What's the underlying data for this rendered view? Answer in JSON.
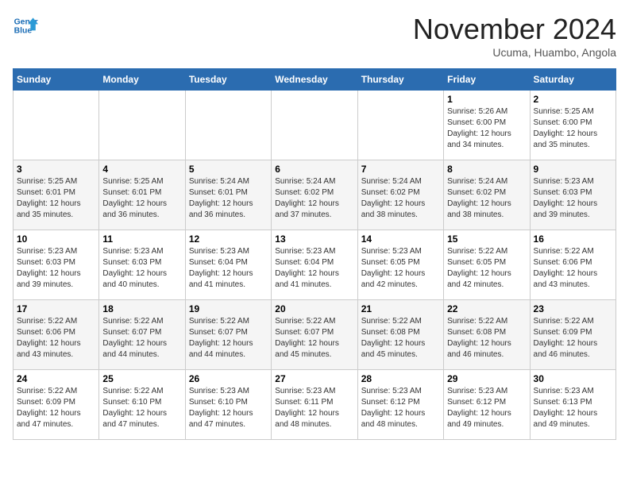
{
  "header": {
    "logo_line1": "General",
    "logo_line2": "Blue",
    "month_title": "November 2024",
    "location": "Ucuma, Huambo, Angola"
  },
  "weekdays": [
    "Sunday",
    "Monday",
    "Tuesday",
    "Wednesday",
    "Thursday",
    "Friday",
    "Saturday"
  ],
  "weeks": [
    [
      {
        "day": "",
        "info": ""
      },
      {
        "day": "",
        "info": ""
      },
      {
        "day": "",
        "info": ""
      },
      {
        "day": "",
        "info": ""
      },
      {
        "day": "",
        "info": ""
      },
      {
        "day": "1",
        "info": "Sunrise: 5:26 AM\nSunset: 6:00 PM\nDaylight: 12 hours and 34 minutes."
      },
      {
        "day": "2",
        "info": "Sunrise: 5:25 AM\nSunset: 6:00 PM\nDaylight: 12 hours and 35 minutes."
      }
    ],
    [
      {
        "day": "3",
        "info": "Sunrise: 5:25 AM\nSunset: 6:01 PM\nDaylight: 12 hours and 35 minutes."
      },
      {
        "day": "4",
        "info": "Sunrise: 5:25 AM\nSunset: 6:01 PM\nDaylight: 12 hours and 36 minutes."
      },
      {
        "day": "5",
        "info": "Sunrise: 5:24 AM\nSunset: 6:01 PM\nDaylight: 12 hours and 36 minutes."
      },
      {
        "day": "6",
        "info": "Sunrise: 5:24 AM\nSunset: 6:02 PM\nDaylight: 12 hours and 37 minutes."
      },
      {
        "day": "7",
        "info": "Sunrise: 5:24 AM\nSunset: 6:02 PM\nDaylight: 12 hours and 38 minutes."
      },
      {
        "day": "8",
        "info": "Sunrise: 5:24 AM\nSunset: 6:02 PM\nDaylight: 12 hours and 38 minutes."
      },
      {
        "day": "9",
        "info": "Sunrise: 5:23 AM\nSunset: 6:03 PM\nDaylight: 12 hours and 39 minutes."
      }
    ],
    [
      {
        "day": "10",
        "info": "Sunrise: 5:23 AM\nSunset: 6:03 PM\nDaylight: 12 hours and 39 minutes."
      },
      {
        "day": "11",
        "info": "Sunrise: 5:23 AM\nSunset: 6:03 PM\nDaylight: 12 hours and 40 minutes."
      },
      {
        "day": "12",
        "info": "Sunrise: 5:23 AM\nSunset: 6:04 PM\nDaylight: 12 hours and 41 minutes."
      },
      {
        "day": "13",
        "info": "Sunrise: 5:23 AM\nSunset: 6:04 PM\nDaylight: 12 hours and 41 minutes."
      },
      {
        "day": "14",
        "info": "Sunrise: 5:23 AM\nSunset: 6:05 PM\nDaylight: 12 hours and 42 minutes."
      },
      {
        "day": "15",
        "info": "Sunrise: 5:22 AM\nSunset: 6:05 PM\nDaylight: 12 hours and 42 minutes."
      },
      {
        "day": "16",
        "info": "Sunrise: 5:22 AM\nSunset: 6:06 PM\nDaylight: 12 hours and 43 minutes."
      }
    ],
    [
      {
        "day": "17",
        "info": "Sunrise: 5:22 AM\nSunset: 6:06 PM\nDaylight: 12 hours and 43 minutes."
      },
      {
        "day": "18",
        "info": "Sunrise: 5:22 AM\nSunset: 6:07 PM\nDaylight: 12 hours and 44 minutes."
      },
      {
        "day": "19",
        "info": "Sunrise: 5:22 AM\nSunset: 6:07 PM\nDaylight: 12 hours and 44 minutes."
      },
      {
        "day": "20",
        "info": "Sunrise: 5:22 AM\nSunset: 6:07 PM\nDaylight: 12 hours and 45 minutes."
      },
      {
        "day": "21",
        "info": "Sunrise: 5:22 AM\nSunset: 6:08 PM\nDaylight: 12 hours and 45 minutes."
      },
      {
        "day": "22",
        "info": "Sunrise: 5:22 AM\nSunset: 6:08 PM\nDaylight: 12 hours and 46 minutes."
      },
      {
        "day": "23",
        "info": "Sunrise: 5:22 AM\nSunset: 6:09 PM\nDaylight: 12 hours and 46 minutes."
      }
    ],
    [
      {
        "day": "24",
        "info": "Sunrise: 5:22 AM\nSunset: 6:09 PM\nDaylight: 12 hours and 47 minutes."
      },
      {
        "day": "25",
        "info": "Sunrise: 5:22 AM\nSunset: 6:10 PM\nDaylight: 12 hours and 47 minutes."
      },
      {
        "day": "26",
        "info": "Sunrise: 5:23 AM\nSunset: 6:10 PM\nDaylight: 12 hours and 47 minutes."
      },
      {
        "day": "27",
        "info": "Sunrise: 5:23 AM\nSunset: 6:11 PM\nDaylight: 12 hours and 48 minutes."
      },
      {
        "day": "28",
        "info": "Sunrise: 5:23 AM\nSunset: 6:12 PM\nDaylight: 12 hours and 48 minutes."
      },
      {
        "day": "29",
        "info": "Sunrise: 5:23 AM\nSunset: 6:12 PM\nDaylight: 12 hours and 49 minutes."
      },
      {
        "day": "30",
        "info": "Sunrise: 5:23 AM\nSunset: 6:13 PM\nDaylight: 12 hours and 49 minutes."
      }
    ]
  ]
}
